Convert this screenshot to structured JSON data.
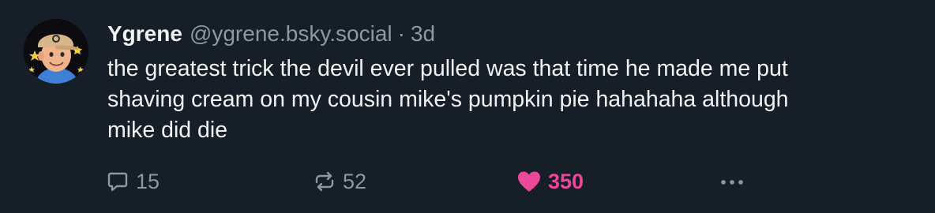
{
  "post": {
    "author": {
      "display_name": "Ygrene",
      "handle": "@ygrene.bsky.social",
      "avatar_icon": "avatar-cartoon-face-icon"
    },
    "separator": "·",
    "timestamp": "3d",
    "text": "the greatest trick the devil ever pulled was that time he made me put\nshaving cream on my cousin mike's pumpkin pie hahahaha although\nmike did die",
    "actions": {
      "reply": {
        "icon": "reply-bubble-icon",
        "count": "15"
      },
      "repost": {
        "icon": "repost-arrows-icon",
        "count": "52"
      },
      "like": {
        "icon": "heart-icon",
        "count": "350",
        "liked": true
      },
      "more": {
        "icon": "more-dots-icon"
      }
    }
  },
  "colors": {
    "background": "#161e27",
    "text_primary": "#f1f3f5",
    "text_secondary": "#8d98a5",
    "like_active": "#ec4899"
  }
}
